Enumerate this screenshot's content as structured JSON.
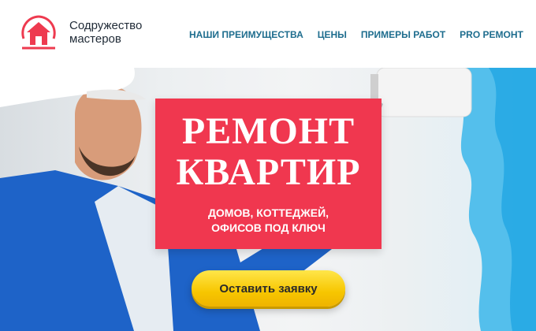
{
  "header": {
    "logo_icon": "house-icon",
    "brand_line1": "Содружество",
    "brand_line2": "мастеров",
    "nav": [
      {
        "label": "НАШИ ПРЕИМУЩЕСТВА"
      },
      {
        "label": "ЦЕНЫ"
      },
      {
        "label": "ПРИМЕРЫ РАБОТ"
      },
      {
        "label": "PRO РЕМОНТ"
      }
    ]
  },
  "hero": {
    "title_line1": "РЕМОНТ",
    "title_line2": "КВАРТИР",
    "subtitle_line1": "ДОМОВ, КОТТЕДЖЕЙ,",
    "subtitle_line2": "ОФИСОВ ПОД КЛЮЧ",
    "cta_label": "Оставить заявку"
  },
  "colors": {
    "accent_red": "#f0374f",
    "nav_blue": "#1e6d8e",
    "button_yellow": "#f7c600",
    "shirt_blue": "#1e63c8",
    "paint_blue": "#3bb6ea"
  }
}
